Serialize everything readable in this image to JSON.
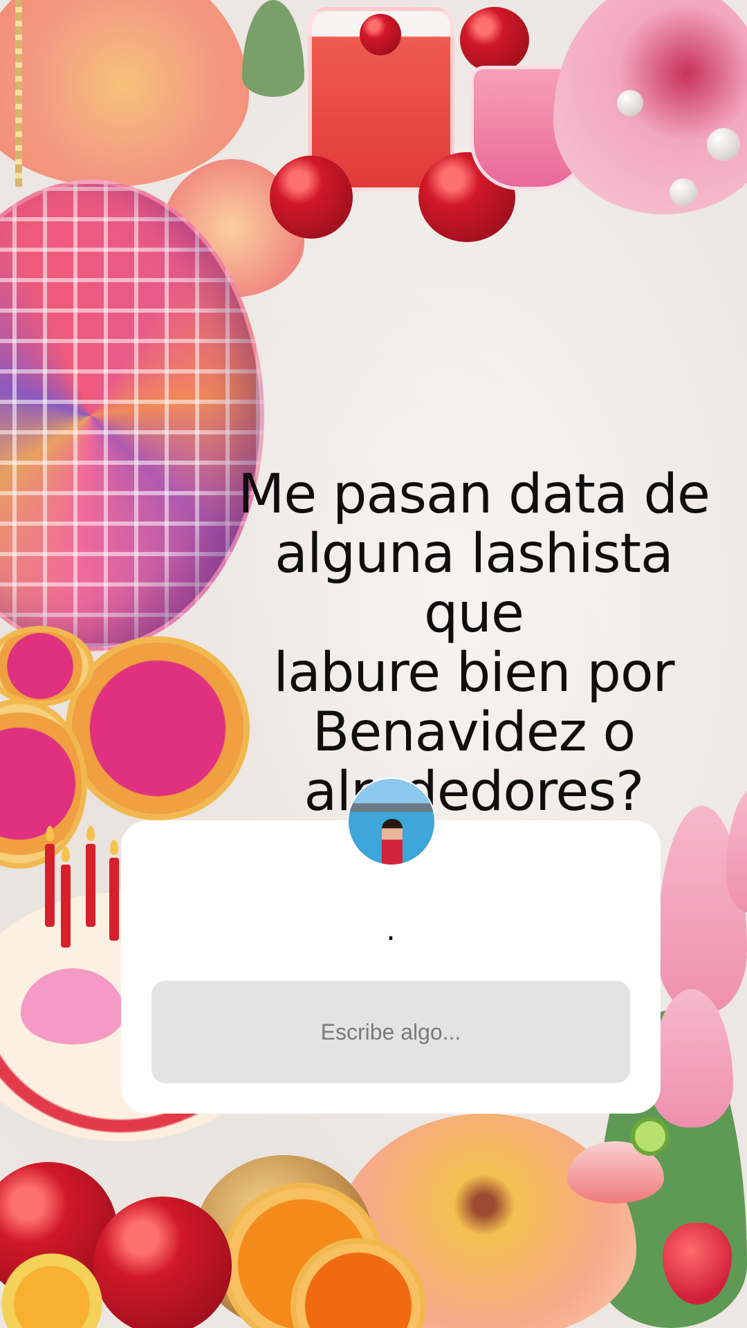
{
  "story": {
    "question": "Me pasan data de\nalguna lashista que\nlabure bien por\nBenavidez o\nalrededores?"
  },
  "reply_card": {
    "avatar_icon": "profile-avatar-icon",
    "response_text": ".",
    "input_placeholder": "Escribe algo..."
  },
  "colors": {
    "card": "#ffffff",
    "input_bg": "#e3e3e3",
    "placeholder": "#7a7a7a",
    "text": "#0e0e0e"
  }
}
